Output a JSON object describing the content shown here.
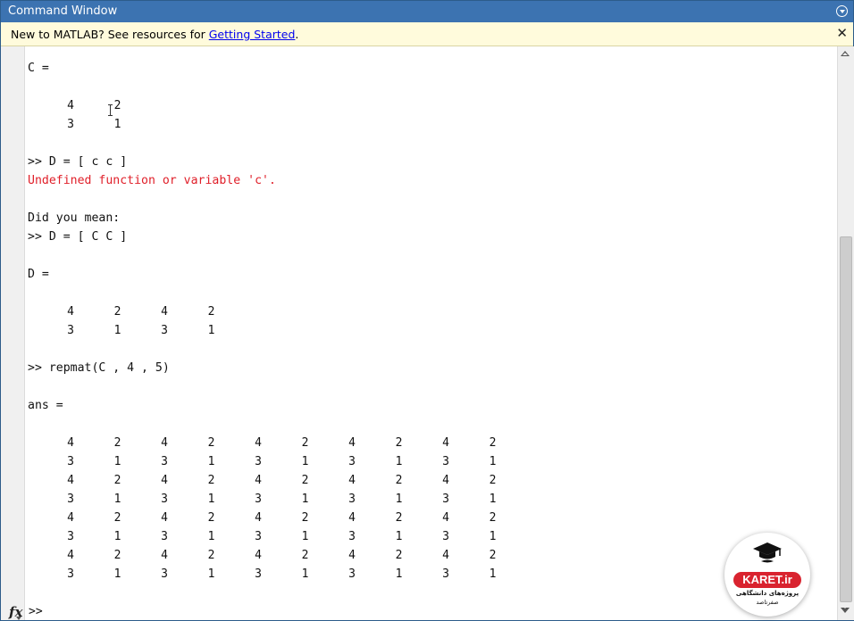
{
  "window": {
    "title": "Command Window"
  },
  "infobar": {
    "prefix": "New to MATLAB? See resources for ",
    "link": "Getting Started",
    "suffix": ".",
    "close_glyph": "✕"
  },
  "console": {
    "lines": [
      {
        "text": "C =",
        "type": "output"
      },
      {
        "text": ">> D = [ c c ]",
        "type": "command"
      },
      {
        "text": "Undefined function or variable 'c'.",
        "type": "error"
      },
      {
        "text": "Did you mean:",
        "type": "output"
      },
      {
        "text": ">> D = [ C C ]",
        "type": "command"
      },
      {
        "text": "D =",
        "type": "output"
      },
      {
        "text": ">> repmat(C , 4 , 5)",
        "type": "command"
      },
      {
        "text": "ans =",
        "type": "output"
      }
    ],
    "C_matrix": [
      [
        "4",
        "2"
      ],
      [
        "3",
        "1"
      ]
    ],
    "D_matrix": [
      [
        "4",
        "2",
        "4",
        "2"
      ],
      [
        "3",
        "1",
        "3",
        "1"
      ]
    ],
    "ans_matrix": [
      [
        "4",
        "2",
        "4",
        "2",
        "4",
        "2",
        "4",
        "2",
        "4",
        "2"
      ],
      [
        "3",
        "1",
        "3",
        "1",
        "3",
        "1",
        "3",
        "1",
        "3",
        "1"
      ],
      [
        "4",
        "2",
        "4",
        "2",
        "4",
        "2",
        "4",
        "2",
        "4",
        "2"
      ],
      [
        "3",
        "1",
        "3",
        "1",
        "3",
        "1",
        "3",
        "1",
        "3",
        "1"
      ],
      [
        "4",
        "2",
        "4",
        "2",
        "4",
        "2",
        "4",
        "2",
        "4",
        "2"
      ],
      [
        "3",
        "1",
        "3",
        "1",
        "3",
        "1",
        "3",
        "1",
        "3",
        "1"
      ],
      [
        "4",
        "2",
        "4",
        "2",
        "4",
        "2",
        "4",
        "2",
        "4",
        "2"
      ],
      [
        "3",
        "1",
        "3",
        "1",
        "3",
        "1",
        "3",
        "1",
        "3",
        "1"
      ]
    ],
    "prompt": ">>",
    "error_color": "#e0202a"
  },
  "fx_label": "fx",
  "icons": {
    "window_menu": "chevron-down-circle-icon",
    "close": "close-icon",
    "function_browser": "fx-icon",
    "cursor": "text-cursor-icon"
  },
  "logo": {
    "name": "KARET.ir",
    "line1": "پروژه‌های دانشگاهی",
    "line2": "صفرتاصد"
  },
  "colors": {
    "titlebar": "#3c73b1",
    "infobar": "#fffbdc",
    "link": "#0000ee"
  }
}
